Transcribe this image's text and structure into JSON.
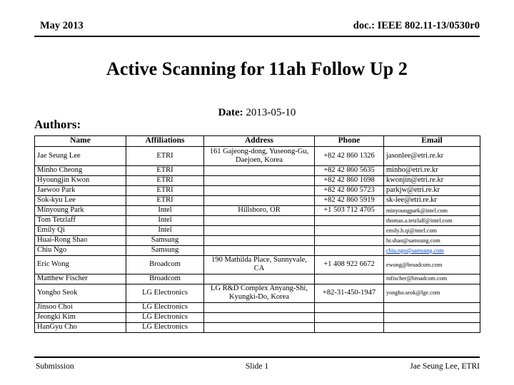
{
  "header": {
    "date": "May 2013",
    "doc": "doc.: IEEE 802.11-13/0530r0"
  },
  "title": "Active Scanning for 11ah Follow Up 2",
  "date_line": {
    "label": "Date:",
    "value": " 2013-05-10"
  },
  "authors_label": "Authors:",
  "table": {
    "columns": [
      "Name",
      "Affiliations",
      "Address",
      "Phone",
      "Email"
    ],
    "rows": [
      {
        "name": "Jae Seung Lee",
        "affiliation": "ETRI",
        "address": "161 Gajeong-dong, Yuseong-Gu, Daejoen, Korea",
        "phone": "+82 42 860 1326",
        "email": "jasonlee@etri.re.kr",
        "email_style": "normal",
        "row_height": "tall"
      },
      {
        "name": "Minho Cheong",
        "affiliation": "ETRI",
        "address": "",
        "phone": "+82 42 860 5635",
        "email": "minho@etri.re.kr",
        "email_style": "normal",
        "row_height": "std"
      },
      {
        "name": "Hyoungjin Kwon",
        "affiliation": "ETRI",
        "address": "",
        "phone": "+82 42 860 1698",
        "email": "kwonjin@etri.re.kr",
        "email_style": "normal",
        "row_height": "std"
      },
      {
        "name": "Jaewoo Park",
        "affiliation": "ETRI",
        "address": "",
        "phone": "+82 42 860 5723",
        "email": "parkjw@etri.re.kr",
        "email_style": "normal",
        "row_height": "std"
      },
      {
        "name": "Sok-kyu Lee",
        "affiliation": "ETRI",
        "address": "",
        "phone": "+82 42 860 5919",
        "email": "sk-lee@etri.re.kr",
        "email_style": "normal",
        "row_height": "std"
      },
      {
        "name": "Minyoung Park",
        "affiliation": "Intel",
        "address": "Hillsboro, OR",
        "phone": "+1 503 712 4705",
        "email": "minyoungpark@intel.com",
        "email_style": "small",
        "row_height": "std"
      },
      {
        "name": "Tom Tetzlaff",
        "affiliation": "Intel",
        "address": "",
        "phone": "",
        "email": "thomas.a.tetzlaff@intel.com",
        "email_style": "small",
        "row_height": "std"
      },
      {
        "name": "Emily Qi",
        "affiliation": "Intel",
        "address": "",
        "phone": "",
        "email": "emily.h.qi@intel.com",
        "email_style": "small",
        "row_height": "std"
      },
      {
        "name": "Huai-Rong Shao",
        "affiliation": "Samsung",
        "address": "",
        "phone": "",
        "email": "hr.shao@samsung.com",
        "email_style": "small",
        "row_height": "std"
      },
      {
        "name": "Chiu Ngo",
        "affiliation": "Samsung",
        "address": "",
        "phone": "",
        "email": "chiu.ngo@samsung.com",
        "email_style": "link",
        "row_height": "std"
      },
      {
        "name": "Eric Wong",
        "affiliation": "Broadcom",
        "address": "190 Mathilda Place, Sunnyvale, CA",
        "phone": "+1 408 922 6672",
        "email": "ewong@broadcom.com",
        "email_style": "small",
        "row_height": "mid"
      },
      {
        "name": "Matthew Fischer",
        "affiliation": "Broadcom",
        "address": "",
        "phone": "",
        "email": "mfischer@broadcom.com",
        "email_style": "small",
        "row_height": "std"
      },
      {
        "name": "Yongho Seok",
        "affiliation": "LG Electronics",
        "address": "LG R&D Complex Anyang-Shi, Kyungki-Do, Korea",
        "phone": "+82-31-450-1947",
        "email": "yongho.seok@lge.com",
        "email_style": "small",
        "row_height": "mid"
      },
      {
        "name": "Jinsoo Choi",
        "affiliation": "LG Electronics",
        "address": "",
        "phone": "",
        "email": "",
        "email_style": "normal",
        "row_height": "std"
      },
      {
        "name": "Jeongki Kim",
        "affiliation": "LG Electronics",
        "address": "",
        "phone": "",
        "email": "",
        "email_style": "normal",
        "row_height": "std"
      },
      {
        "name": "HanGyu Cho",
        "affiliation": "LG Electronics",
        "address": "",
        "phone": "",
        "email": "",
        "email_style": "normal",
        "row_height": "std"
      }
    ]
  },
  "footer": {
    "left": "Submission",
    "center": "Slide 1",
    "right": "Jae Seung Lee, ETRI"
  },
  "colors": {
    "text": "#000000",
    "link": "#0a48c8",
    "background": "#ffffff"
  }
}
